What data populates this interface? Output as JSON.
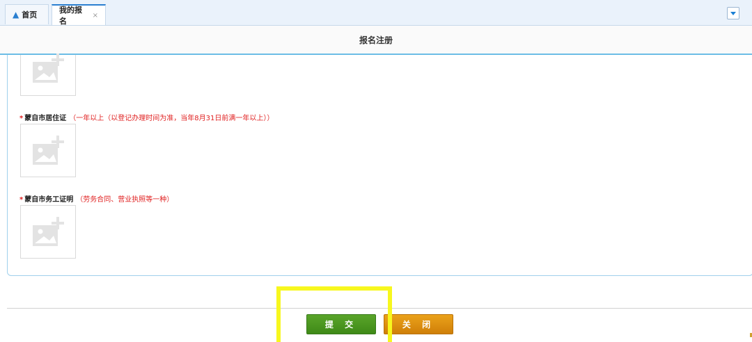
{
  "tabs": {
    "home_label": "首页",
    "active_label": "我的报名",
    "close_glyph": "×"
  },
  "panel": {
    "title": "报名注册"
  },
  "fields": [
    {
      "required_mark": "*",
      "label": "蒙自市居住证",
      "note": "（一年以上（以登记办理时间为准，当年8月31日前满一年以上））"
    },
    {
      "required_mark": "*",
      "label": "蒙自市务工证明",
      "note": "（劳务合同、营业执照等一种）"
    }
  ],
  "actions": {
    "submit_label": "提 交",
    "close_label": "关 闭"
  },
  "colors": {
    "accent_blue": "#2a7fd0",
    "required_red": "#e02020",
    "submit_green": "#3f8a17",
    "close_orange": "#cf7f08",
    "highlight_yellow": "#f7f71e"
  },
  "icons": {
    "home": "home-icon",
    "image_upload": "image-placeholder-icon",
    "dropdown": "chevron-down-icon"
  }
}
